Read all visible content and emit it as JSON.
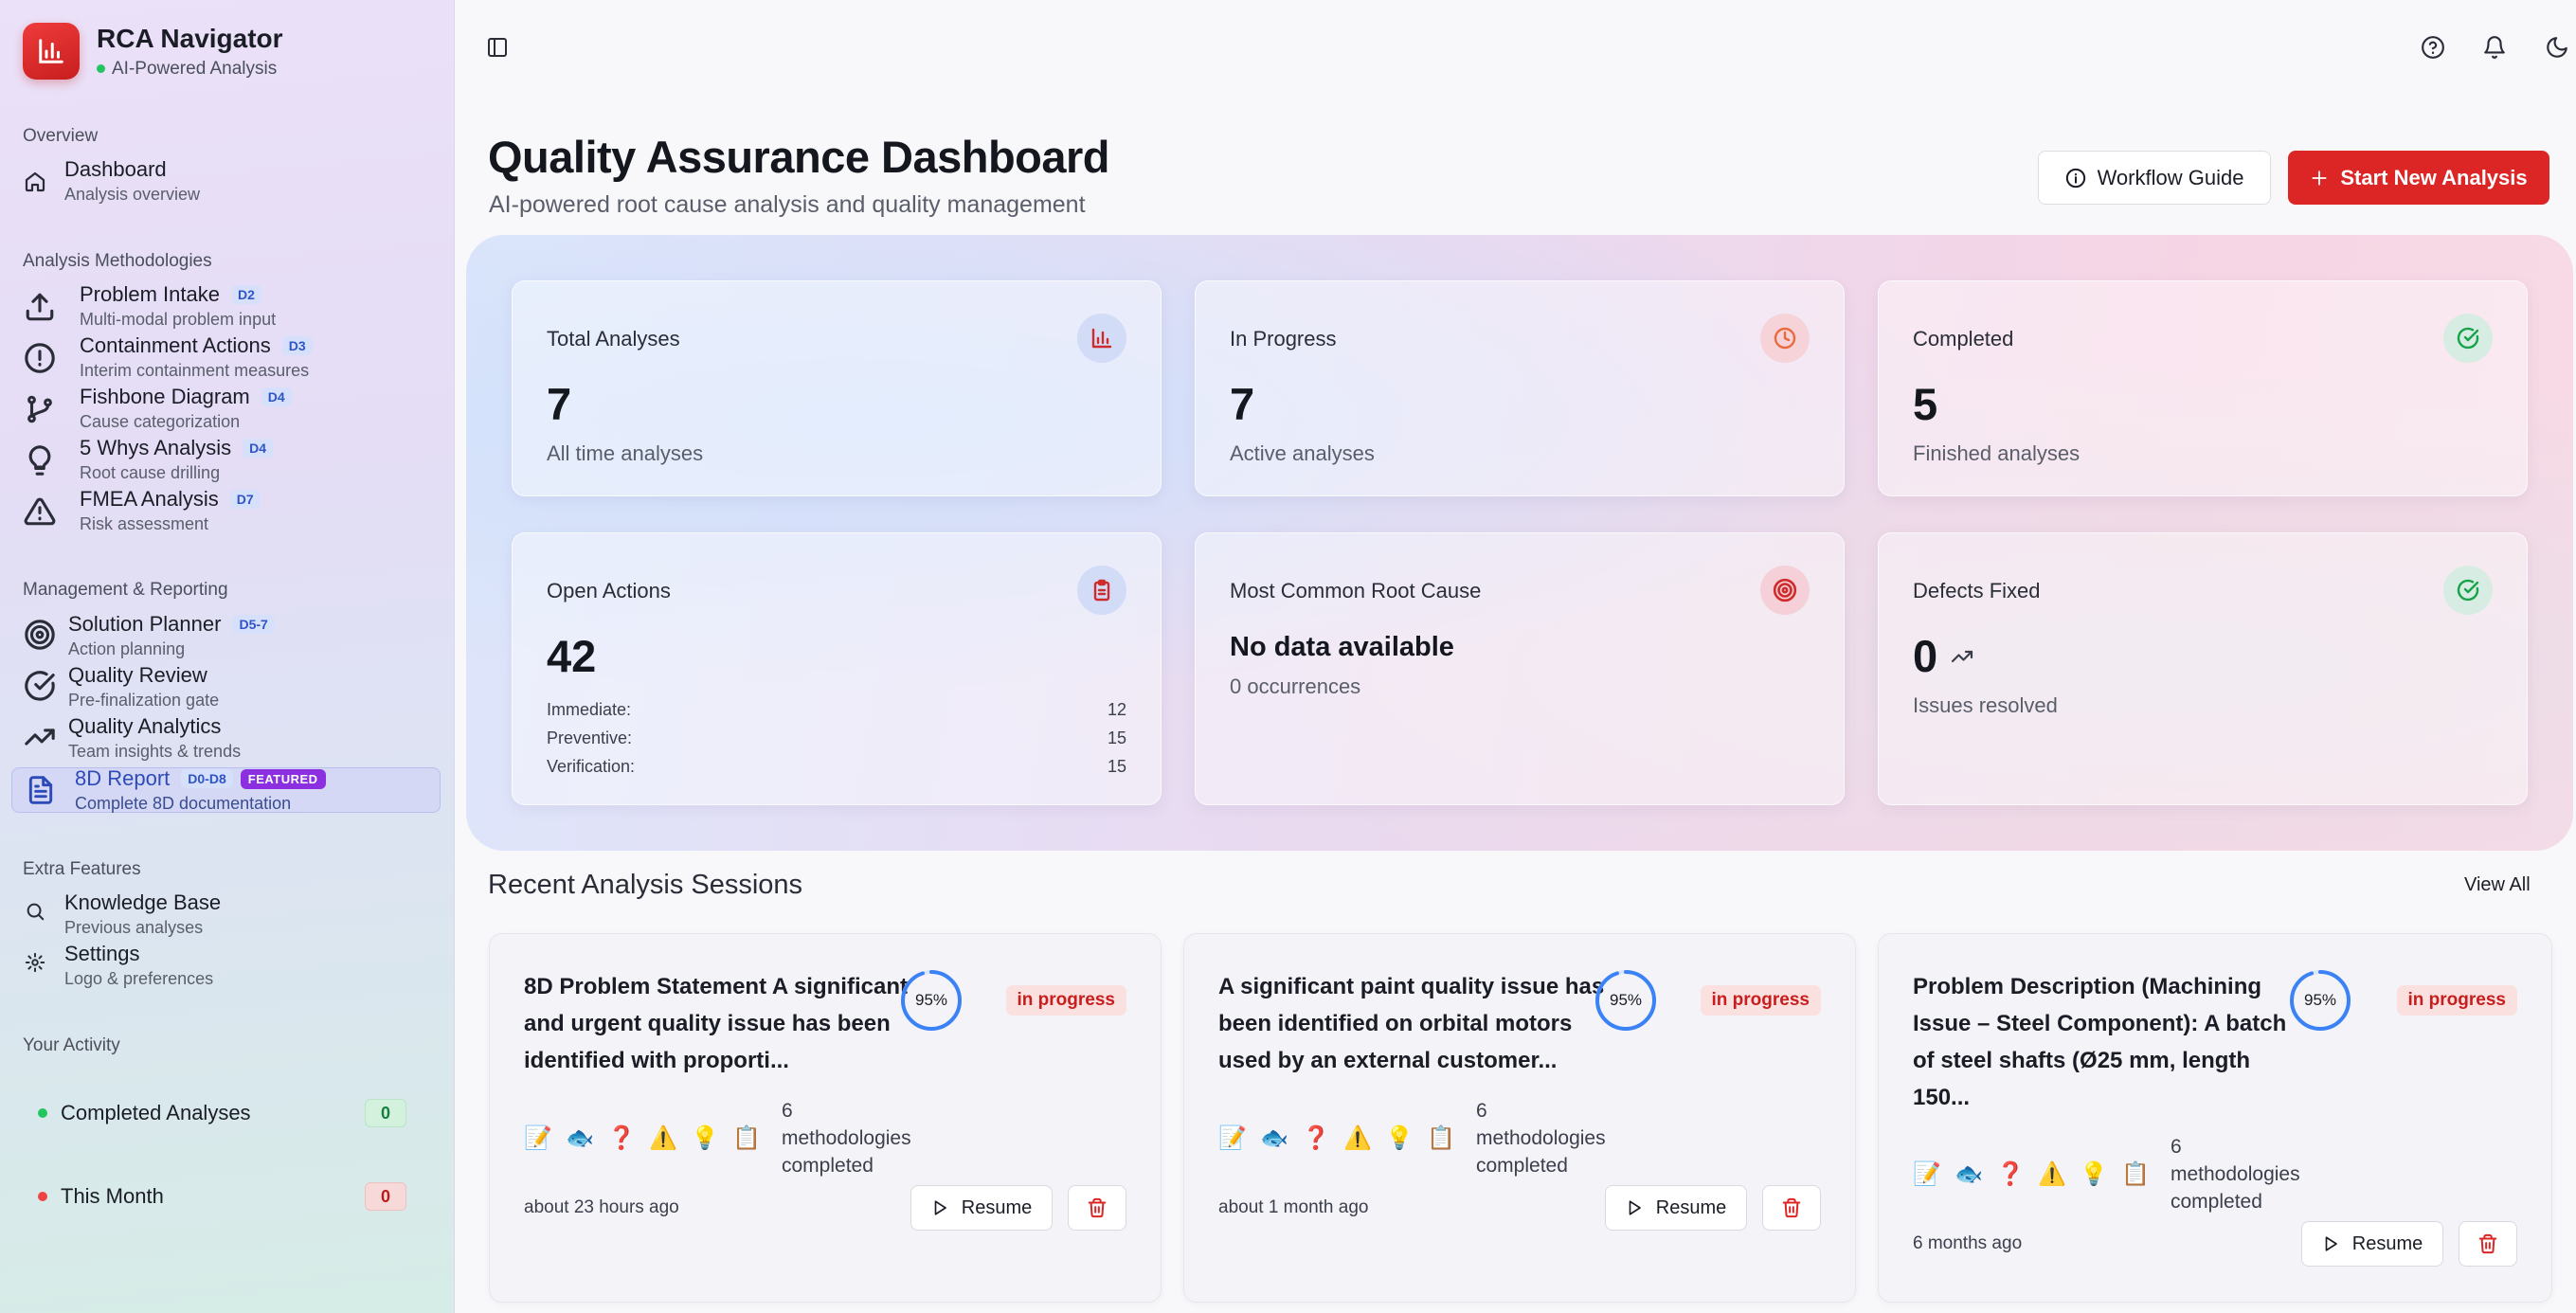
{
  "app": {
    "title": "RCA Navigator",
    "status": "AI-Powered Analysis",
    "brand_color": "#dc2626"
  },
  "sidebar": {
    "overview_label": "Overview",
    "dashboard": {
      "title": "Dashboard",
      "desc": "Analysis overview",
      "icon": "home-icon"
    },
    "methodologies_label": "Analysis Methodologies",
    "methodologies": [
      {
        "title": "Problem Intake",
        "badge": "D2",
        "desc": "Multi-modal problem input",
        "icon": "upload-icon"
      },
      {
        "title": "Containment Actions",
        "badge": "D3",
        "desc": "Interim containment measures",
        "icon": "alert-circle-icon"
      },
      {
        "title": "Fishbone Diagram",
        "badge": "D4",
        "desc": "Cause categorization",
        "icon": "git-branch-icon"
      },
      {
        "title": "5 Whys Analysis",
        "badge": "D4",
        "desc": "Root cause drilling",
        "icon": "lightbulb-icon"
      },
      {
        "title": "FMEA Analysis",
        "badge": "D7",
        "desc": "Risk assessment",
        "icon": "warning-triangle-icon"
      }
    ],
    "management_label": "Management & Reporting",
    "management": [
      {
        "title": "Solution Planner",
        "badge": "D5-7",
        "desc": "Action planning",
        "icon": "target-icon"
      },
      {
        "title": "Quality Review",
        "desc": "Pre-finalization gate",
        "icon": "check-circle-icon"
      },
      {
        "title": "Quality Analytics",
        "desc": "Team insights & trends",
        "icon": "trending-up-icon"
      },
      {
        "title": "8D Report",
        "badge": "D0-D8",
        "featured": "FEATURED",
        "desc": "Complete 8D documentation",
        "icon": "file-text-icon"
      }
    ],
    "extra_label": "Extra Features",
    "extra": [
      {
        "title": "Knowledge Base",
        "desc": "Previous analyses",
        "icon": "search-icon"
      },
      {
        "title": "Settings",
        "desc": "Logo & preferences",
        "icon": "gear-icon"
      }
    ],
    "activity_label": "Your Activity",
    "activity": [
      {
        "label": "Completed Analyses",
        "count": "0",
        "color": "#22c55e"
      },
      {
        "label": "This Month",
        "count": "0",
        "color": "#ef4444"
      }
    ]
  },
  "topbar": {
    "icons": [
      "sidebar-toggle-icon",
      "help-icon",
      "bell-icon",
      "moon-icon"
    ]
  },
  "header": {
    "title": "Quality Assurance Dashboard",
    "subtitle": "AI-powered root cause analysis and quality management",
    "guide_button": "Workflow Guide",
    "start_button": "Start New Analysis"
  },
  "stats": {
    "total": {
      "label": "Total Analyses",
      "value": "7",
      "sub": "All time analyses",
      "icon": "bar-chart-icon"
    },
    "in_progress": {
      "label": "In Progress",
      "value": "7",
      "sub": "Active analyses",
      "icon": "clock-icon"
    },
    "completed": {
      "label": "Completed",
      "value": "5",
      "sub": "Finished analyses",
      "icon": "check-circle-icon"
    },
    "open_actions": {
      "label": "Open Actions",
      "value": "42",
      "icon": "clipboard-icon",
      "breakdown": [
        {
          "label": "Immediate:",
          "value": "12"
        },
        {
          "label": "Preventive:",
          "value": "15"
        },
        {
          "label": "Verification:",
          "value": "15"
        }
      ]
    },
    "root_cause": {
      "label": "Most Common Root Cause",
      "value": "No data available",
      "sub": "0 occurrences",
      "icon": "target-icon"
    },
    "defects": {
      "label": "Defects Fixed",
      "value": "0",
      "sub": "Issues resolved",
      "icon": "check-circle-icon"
    }
  },
  "recent": {
    "title": "Recent Analysis Sessions",
    "view_all": "View All",
    "sessions": [
      {
        "title": "8D Problem Statement A significant and urgent quality issue has been identified with       proporti...",
        "progress": "95%",
        "progress_value": 0.95,
        "status": "in progress",
        "methods": [
          "📝",
          "🐟",
          "❓",
          "⚠️",
          "💡",
          "📋"
        ],
        "methods_text": "6 methodologies completed",
        "time": "about 23 hours ago",
        "resume": "Resume"
      },
      {
        "title": "A significant paint quality issue has been identified on orbital motors used by an external customer...",
        "progress": "95%",
        "progress_value": 0.95,
        "status": "in progress",
        "methods": [
          "📝",
          "🐟",
          "❓",
          "⚠️",
          "💡",
          "📋"
        ],
        "methods_text": "6 methodologies completed",
        "time": "about 1 month ago",
        "resume": "Resume"
      },
      {
        "title": "Problem Description (Machining Issue – Steel Component): A batch of steel shafts (Ø25 mm, length 150...",
        "progress": "95%",
        "progress_value": 0.95,
        "status": "in progress",
        "methods": [
          "📝",
          "🐟",
          "❓",
          "⚠️",
          "💡",
          "📋"
        ],
        "methods_text": "6 methodologies completed",
        "time": "6 months ago",
        "resume": "Resume"
      }
    ]
  }
}
